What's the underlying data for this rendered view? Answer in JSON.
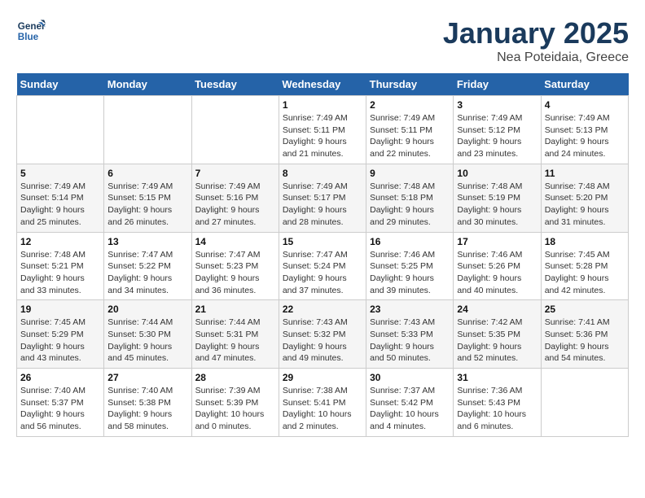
{
  "header": {
    "logo_line1": "General",
    "logo_line2": "Blue",
    "title": "January 2025",
    "subtitle": "Nea Poteidaia, Greece"
  },
  "weekdays": [
    "Sunday",
    "Monday",
    "Tuesday",
    "Wednesday",
    "Thursday",
    "Friday",
    "Saturday"
  ],
  "weeks": [
    [
      {
        "day": "",
        "info": ""
      },
      {
        "day": "",
        "info": ""
      },
      {
        "day": "",
        "info": ""
      },
      {
        "day": "1",
        "info": "Sunrise: 7:49 AM\nSunset: 5:11 PM\nDaylight: 9 hours\nand 21 minutes."
      },
      {
        "day": "2",
        "info": "Sunrise: 7:49 AM\nSunset: 5:11 PM\nDaylight: 9 hours\nand 22 minutes."
      },
      {
        "day": "3",
        "info": "Sunrise: 7:49 AM\nSunset: 5:12 PM\nDaylight: 9 hours\nand 23 minutes."
      },
      {
        "day": "4",
        "info": "Sunrise: 7:49 AM\nSunset: 5:13 PM\nDaylight: 9 hours\nand 24 minutes."
      }
    ],
    [
      {
        "day": "5",
        "info": "Sunrise: 7:49 AM\nSunset: 5:14 PM\nDaylight: 9 hours\nand 25 minutes."
      },
      {
        "day": "6",
        "info": "Sunrise: 7:49 AM\nSunset: 5:15 PM\nDaylight: 9 hours\nand 26 minutes."
      },
      {
        "day": "7",
        "info": "Sunrise: 7:49 AM\nSunset: 5:16 PM\nDaylight: 9 hours\nand 27 minutes."
      },
      {
        "day": "8",
        "info": "Sunrise: 7:49 AM\nSunset: 5:17 PM\nDaylight: 9 hours\nand 28 minutes."
      },
      {
        "day": "9",
        "info": "Sunrise: 7:48 AM\nSunset: 5:18 PM\nDaylight: 9 hours\nand 29 minutes."
      },
      {
        "day": "10",
        "info": "Sunrise: 7:48 AM\nSunset: 5:19 PM\nDaylight: 9 hours\nand 30 minutes."
      },
      {
        "day": "11",
        "info": "Sunrise: 7:48 AM\nSunset: 5:20 PM\nDaylight: 9 hours\nand 31 minutes."
      }
    ],
    [
      {
        "day": "12",
        "info": "Sunrise: 7:48 AM\nSunset: 5:21 PM\nDaylight: 9 hours\nand 33 minutes."
      },
      {
        "day": "13",
        "info": "Sunrise: 7:47 AM\nSunset: 5:22 PM\nDaylight: 9 hours\nand 34 minutes."
      },
      {
        "day": "14",
        "info": "Sunrise: 7:47 AM\nSunset: 5:23 PM\nDaylight: 9 hours\nand 36 minutes."
      },
      {
        "day": "15",
        "info": "Sunrise: 7:47 AM\nSunset: 5:24 PM\nDaylight: 9 hours\nand 37 minutes."
      },
      {
        "day": "16",
        "info": "Sunrise: 7:46 AM\nSunset: 5:25 PM\nDaylight: 9 hours\nand 39 minutes."
      },
      {
        "day": "17",
        "info": "Sunrise: 7:46 AM\nSunset: 5:26 PM\nDaylight: 9 hours\nand 40 minutes."
      },
      {
        "day": "18",
        "info": "Sunrise: 7:45 AM\nSunset: 5:28 PM\nDaylight: 9 hours\nand 42 minutes."
      }
    ],
    [
      {
        "day": "19",
        "info": "Sunrise: 7:45 AM\nSunset: 5:29 PM\nDaylight: 9 hours\nand 43 minutes."
      },
      {
        "day": "20",
        "info": "Sunrise: 7:44 AM\nSunset: 5:30 PM\nDaylight: 9 hours\nand 45 minutes."
      },
      {
        "day": "21",
        "info": "Sunrise: 7:44 AM\nSunset: 5:31 PM\nDaylight: 9 hours\nand 47 minutes."
      },
      {
        "day": "22",
        "info": "Sunrise: 7:43 AM\nSunset: 5:32 PM\nDaylight: 9 hours\nand 49 minutes."
      },
      {
        "day": "23",
        "info": "Sunrise: 7:43 AM\nSunset: 5:33 PM\nDaylight: 9 hours\nand 50 minutes."
      },
      {
        "day": "24",
        "info": "Sunrise: 7:42 AM\nSunset: 5:35 PM\nDaylight: 9 hours\nand 52 minutes."
      },
      {
        "day": "25",
        "info": "Sunrise: 7:41 AM\nSunset: 5:36 PM\nDaylight: 9 hours\nand 54 minutes."
      }
    ],
    [
      {
        "day": "26",
        "info": "Sunrise: 7:40 AM\nSunset: 5:37 PM\nDaylight: 9 hours\nand 56 minutes."
      },
      {
        "day": "27",
        "info": "Sunrise: 7:40 AM\nSunset: 5:38 PM\nDaylight: 9 hours\nand 58 minutes."
      },
      {
        "day": "28",
        "info": "Sunrise: 7:39 AM\nSunset: 5:39 PM\nDaylight: 10 hours\nand 0 minutes."
      },
      {
        "day": "29",
        "info": "Sunrise: 7:38 AM\nSunset: 5:41 PM\nDaylight: 10 hours\nand 2 minutes."
      },
      {
        "day": "30",
        "info": "Sunrise: 7:37 AM\nSunset: 5:42 PM\nDaylight: 10 hours\nand 4 minutes."
      },
      {
        "day": "31",
        "info": "Sunrise: 7:36 AM\nSunset: 5:43 PM\nDaylight: 10 hours\nand 6 minutes."
      },
      {
        "day": "",
        "info": ""
      }
    ]
  ]
}
